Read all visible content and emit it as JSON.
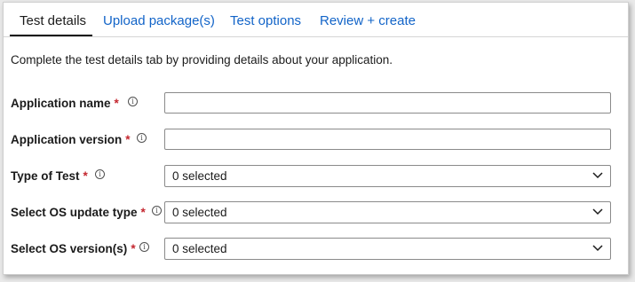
{
  "tabs": [
    {
      "label": "Test details",
      "active": true
    },
    {
      "label": "Upload package(s)",
      "active": false
    },
    {
      "label": "Test options",
      "active": false
    },
    {
      "label": "Review + create",
      "active": false
    }
  ],
  "description": "Complete the test details tab by providing details about your application.",
  "form": {
    "application_name": {
      "label": "Application name",
      "required_mark": "*",
      "value": ""
    },
    "application_version": {
      "label": "Application version",
      "required_mark": "*",
      "value": ""
    },
    "type_of_test": {
      "label": "Type of Test",
      "required_mark": "*",
      "value": "0 selected"
    },
    "os_update_type": {
      "label": "Select OS update type",
      "required_mark": "*",
      "value": "0 selected"
    },
    "os_versions": {
      "label": "Select OS version(s)",
      "required_mark": "*",
      "value": "0 selected"
    }
  },
  "icons": {
    "info": "info-icon",
    "dropdown": "chevron-down-icon"
  },
  "colors": {
    "link": "#1264c8",
    "required": "#c4262e",
    "active_tab": "#1b1b1b"
  }
}
